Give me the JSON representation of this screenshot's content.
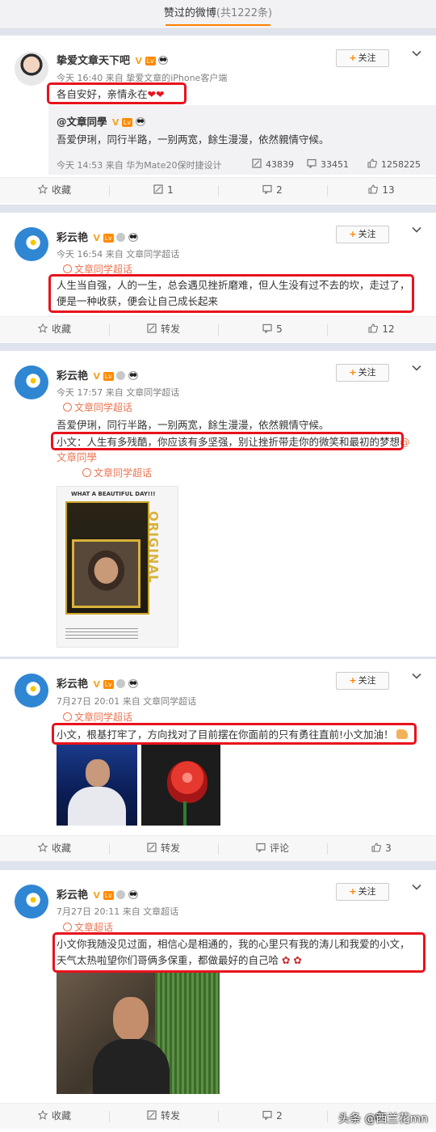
{
  "header": {
    "title": "赞过的微博",
    "count": "(共1222条)"
  },
  "common": {
    "follow_label": "关注",
    "collect_label": "收藏",
    "repost_label": "转发",
    "comment_label": "评论"
  },
  "posts": [
    {
      "username": "挚爱文章天下吧",
      "meta": "今天 16:40 来自 挚爱文章的iPhone客户端",
      "text": "各自安好，亲情永在",
      "repost": {
        "user": "@文章同學",
        "text": "吾爱伊琍，同行半路，一别两宽，餘生漫漫，依然親情守候。",
        "meta": "今天 14:53 来自 华为Mate20保时捷设计",
        "reposts": "43839",
        "comments": "33451",
        "likes": "1258225"
      },
      "actions": {
        "repost_count": "1",
        "comment_count": "2",
        "like_count": "13"
      }
    },
    {
      "username": "彩云艳",
      "meta": "今天 16:54 来自 文章同学超话",
      "supertopic": "文章同学超话",
      "text_line1": "人生当自强，人的一生，总会遇见挫折磨难，但人生没有过不去的坎，走过了，",
      "text_line2": "便是一种收获，便会让自己成长起来",
      "actions": {
        "comment_count": "5",
        "like_count": "12"
      }
    },
    {
      "username": "彩云艳",
      "meta": "今天 17:57 来自 文章同学超话",
      "supertopic": "文章同学超话",
      "text_line1": "吾爱伊琍，同行半路，一别两宽，餘生漫漫，依然親情守候。",
      "text_line2": "小文：人生有多残酷，你应该有多坚强，别让挫折带走你的微笑和最初的梦想",
      "mention_at": "@",
      "mention_name": "文章同學",
      "supertopic2": "文章同学超话",
      "poster_caption": "WHAT A BEAUTIFUL DAY!!!",
      "poster_vertical": "ORIGINAL"
    },
    {
      "username": "彩云艳",
      "meta": "7月27日 20:01 来自 文章同学超话",
      "supertopic": "文章同学超话",
      "text": "小文，根基打牢了，方向找对了目前摆在你面前的只有勇往直前!小文加油！",
      "actions": {
        "like_count": "3"
      }
    },
    {
      "username": "彩云艳",
      "meta": "7月27日 20:11 来自 文章超话",
      "supertopic": "文章超话",
      "text_line1": "小文你我随没见过面，相信心是相通的，我的心里只有我的涛儿和我爱的小文，",
      "text_line2": "天气太热啦望你们哥俩多保重，都做最好的自己哈",
      "actions": {
        "comment_count": "2"
      }
    }
  ],
  "watermark": "头条 @西兰花mn",
  "colors": {
    "accent": "#ff8200",
    "highlight_box": "#e8121c",
    "link": "#eb7350",
    "page_bg": "#dfe3ee"
  }
}
